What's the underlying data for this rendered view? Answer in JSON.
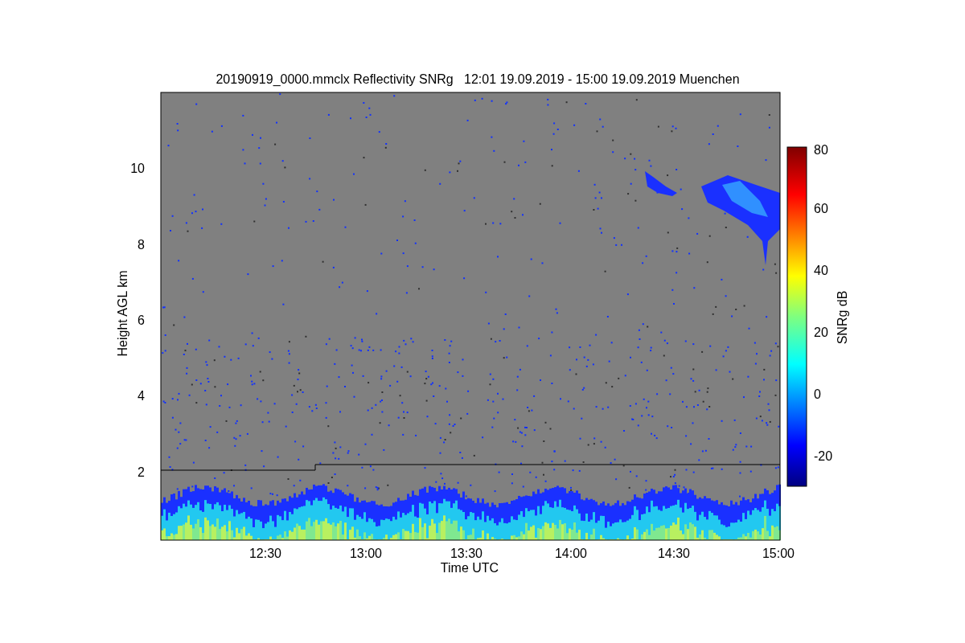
{
  "figure": {
    "title": "20190919_0000.mmclx Reflectivity SNRg   12:01 19.09.2019 - 15:00 19.09.2019 Muenchen",
    "ylabel": "Height AGL km",
    "xlabel": "Time UTC",
    "yticks": [
      "10",
      "8",
      "6",
      "4",
      "2"
    ],
    "xticks": [
      "12:30",
      "13:00",
      "13:30",
      "14:00",
      "14:30",
      "15:00"
    ],
    "colorbar": {
      "label": "SNRg dB",
      "ticks": [
        "80",
        "60",
        "40",
        "20",
        "0",
        "-20"
      ]
    }
  }
}
